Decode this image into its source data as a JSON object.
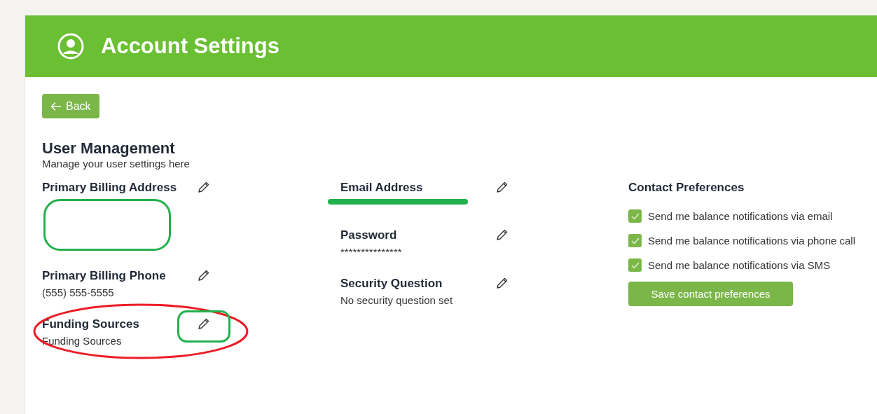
{
  "header": {
    "title": "Account Settings"
  },
  "back_button": {
    "label": "Back"
  },
  "section": {
    "title": "User Management",
    "subtitle": "Manage your user settings here"
  },
  "columns": [
    {
      "fields": [
        {
          "label": "Primary Billing Address",
          "marks": [
            {
              "kind": "cover-box",
              "color": "#22b14c"
            }
          ]
        },
        {
          "label": "Primary Billing Phone",
          "value": "(555) 555-5555"
        },
        {
          "label": "Funding Sources",
          "value": "Funding Sources",
          "marks": [
            {
              "kind": "ring",
              "color": "#ed1c24"
            },
            {
              "kind": "icon-ring",
              "color": "#22b14c"
            }
          ]
        }
      ]
    },
    {
      "fields": [
        {
          "label": "Email Address",
          "marks": [
            {
              "kind": "cover-stroke",
              "color": "#22b14c"
            }
          ]
        },
        {
          "label": "Password",
          "value": "***************"
        },
        {
          "label": "Security Question",
          "value": "No security question set"
        }
      ]
    }
  ],
  "contact_preferences": {
    "title": "Contact Preferences",
    "options": [
      {
        "label": "Send me balance notifications via email",
        "checked": true
      },
      {
        "label": "Send me balance notifications via phone call",
        "checked": true
      },
      {
        "label": "Send me balance notifications via SMS",
        "checked": true
      }
    ],
    "save_button": "Save contact preferences"
  }
}
